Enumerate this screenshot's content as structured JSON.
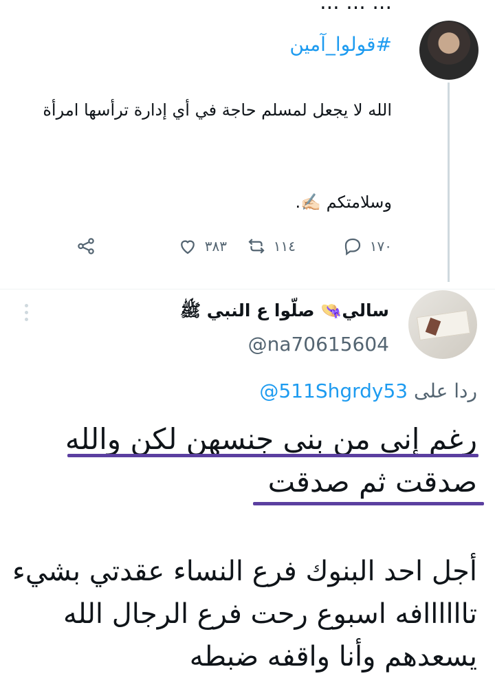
{
  "tweet1": {
    "top_cut_text": "... ... ...",
    "hashtag": "#قولوا_آمين",
    "text": "الله لا يجعل لمسلم حاجة في أي إدارة ترأسها امرأة",
    "sign_off": "وسلامتكم ✍🏻.",
    "actions": {
      "replies": "١٧٠",
      "retweets": "١١٤",
      "likes": "٣٨٣"
    }
  },
  "tweet2": {
    "name": "سالي👒 صلّوا ع النبي ﷺ",
    "handle": "@na70615604",
    "replying_prefix": "ردا على",
    "replying_to": "@511Shgrdy53",
    "line1": "رغم إني من بنى جنسهن لكن والله",
    "line2": "صدقت ثم صدقت",
    "body": "أجل احد البنوك فرع النساء عقدتي بشيء تاااااافه اسبوع رحت فرع الرجال الله يسعدهم وأنا واقفه ضبطه"
  },
  "colors": {
    "accent": "#1d9bf0",
    "muted": "#536471",
    "underline": "#5b3fa0"
  },
  "icons": [
    "reply-icon",
    "retweet-icon",
    "like-icon",
    "share-icon",
    "more-icon"
  ]
}
